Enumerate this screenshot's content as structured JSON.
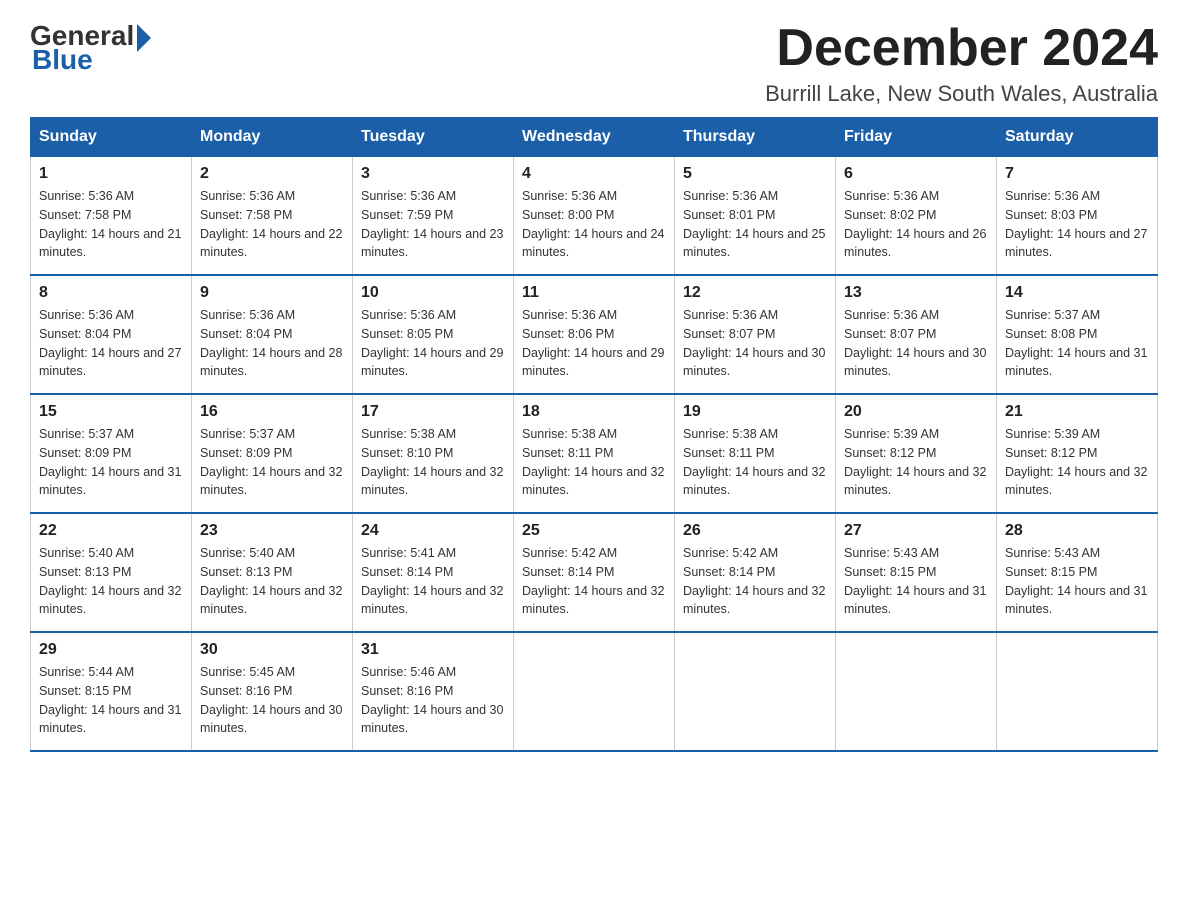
{
  "header": {
    "logo": {
      "general": "General",
      "blue": "Blue"
    },
    "title": "December 2024",
    "location": "Burrill Lake, New South Wales, Australia"
  },
  "weekdays": [
    "Sunday",
    "Monday",
    "Tuesday",
    "Wednesday",
    "Thursday",
    "Friday",
    "Saturday"
  ],
  "weeks": [
    [
      {
        "day": "1",
        "sunrise": "5:36 AM",
        "sunset": "7:58 PM",
        "daylight": "14 hours and 21 minutes."
      },
      {
        "day": "2",
        "sunrise": "5:36 AM",
        "sunset": "7:58 PM",
        "daylight": "14 hours and 22 minutes."
      },
      {
        "day": "3",
        "sunrise": "5:36 AM",
        "sunset": "7:59 PM",
        "daylight": "14 hours and 23 minutes."
      },
      {
        "day": "4",
        "sunrise": "5:36 AM",
        "sunset": "8:00 PM",
        "daylight": "14 hours and 24 minutes."
      },
      {
        "day": "5",
        "sunrise": "5:36 AM",
        "sunset": "8:01 PM",
        "daylight": "14 hours and 25 minutes."
      },
      {
        "day": "6",
        "sunrise": "5:36 AM",
        "sunset": "8:02 PM",
        "daylight": "14 hours and 26 minutes."
      },
      {
        "day": "7",
        "sunrise": "5:36 AM",
        "sunset": "8:03 PM",
        "daylight": "14 hours and 27 minutes."
      }
    ],
    [
      {
        "day": "8",
        "sunrise": "5:36 AM",
        "sunset": "8:04 PM",
        "daylight": "14 hours and 27 minutes."
      },
      {
        "day": "9",
        "sunrise": "5:36 AM",
        "sunset": "8:04 PM",
        "daylight": "14 hours and 28 minutes."
      },
      {
        "day": "10",
        "sunrise": "5:36 AM",
        "sunset": "8:05 PM",
        "daylight": "14 hours and 29 minutes."
      },
      {
        "day": "11",
        "sunrise": "5:36 AM",
        "sunset": "8:06 PM",
        "daylight": "14 hours and 29 minutes."
      },
      {
        "day": "12",
        "sunrise": "5:36 AM",
        "sunset": "8:07 PM",
        "daylight": "14 hours and 30 minutes."
      },
      {
        "day": "13",
        "sunrise": "5:36 AM",
        "sunset": "8:07 PM",
        "daylight": "14 hours and 30 minutes."
      },
      {
        "day": "14",
        "sunrise": "5:37 AM",
        "sunset": "8:08 PM",
        "daylight": "14 hours and 31 minutes."
      }
    ],
    [
      {
        "day": "15",
        "sunrise": "5:37 AM",
        "sunset": "8:09 PM",
        "daylight": "14 hours and 31 minutes."
      },
      {
        "day": "16",
        "sunrise": "5:37 AM",
        "sunset": "8:09 PM",
        "daylight": "14 hours and 32 minutes."
      },
      {
        "day": "17",
        "sunrise": "5:38 AM",
        "sunset": "8:10 PM",
        "daylight": "14 hours and 32 minutes."
      },
      {
        "day": "18",
        "sunrise": "5:38 AM",
        "sunset": "8:11 PM",
        "daylight": "14 hours and 32 minutes."
      },
      {
        "day": "19",
        "sunrise": "5:38 AM",
        "sunset": "8:11 PM",
        "daylight": "14 hours and 32 minutes."
      },
      {
        "day": "20",
        "sunrise": "5:39 AM",
        "sunset": "8:12 PM",
        "daylight": "14 hours and 32 minutes."
      },
      {
        "day": "21",
        "sunrise": "5:39 AM",
        "sunset": "8:12 PM",
        "daylight": "14 hours and 32 minutes."
      }
    ],
    [
      {
        "day": "22",
        "sunrise": "5:40 AM",
        "sunset": "8:13 PM",
        "daylight": "14 hours and 32 minutes."
      },
      {
        "day": "23",
        "sunrise": "5:40 AM",
        "sunset": "8:13 PM",
        "daylight": "14 hours and 32 minutes."
      },
      {
        "day": "24",
        "sunrise": "5:41 AM",
        "sunset": "8:14 PM",
        "daylight": "14 hours and 32 minutes."
      },
      {
        "day": "25",
        "sunrise": "5:42 AM",
        "sunset": "8:14 PM",
        "daylight": "14 hours and 32 minutes."
      },
      {
        "day": "26",
        "sunrise": "5:42 AM",
        "sunset": "8:14 PM",
        "daylight": "14 hours and 32 minutes."
      },
      {
        "day": "27",
        "sunrise": "5:43 AM",
        "sunset": "8:15 PM",
        "daylight": "14 hours and 31 minutes."
      },
      {
        "day": "28",
        "sunrise": "5:43 AM",
        "sunset": "8:15 PM",
        "daylight": "14 hours and 31 minutes."
      }
    ],
    [
      {
        "day": "29",
        "sunrise": "5:44 AM",
        "sunset": "8:15 PM",
        "daylight": "14 hours and 31 minutes."
      },
      {
        "day": "30",
        "sunrise": "5:45 AM",
        "sunset": "8:16 PM",
        "daylight": "14 hours and 30 minutes."
      },
      {
        "day": "31",
        "sunrise": "5:46 AM",
        "sunset": "8:16 PM",
        "daylight": "14 hours and 30 minutes."
      },
      {
        "day": "",
        "sunrise": "",
        "sunset": "",
        "daylight": ""
      },
      {
        "day": "",
        "sunrise": "",
        "sunset": "",
        "daylight": ""
      },
      {
        "day": "",
        "sunrise": "",
        "sunset": "",
        "daylight": ""
      },
      {
        "day": "",
        "sunrise": "",
        "sunset": "",
        "daylight": ""
      }
    ]
  ]
}
